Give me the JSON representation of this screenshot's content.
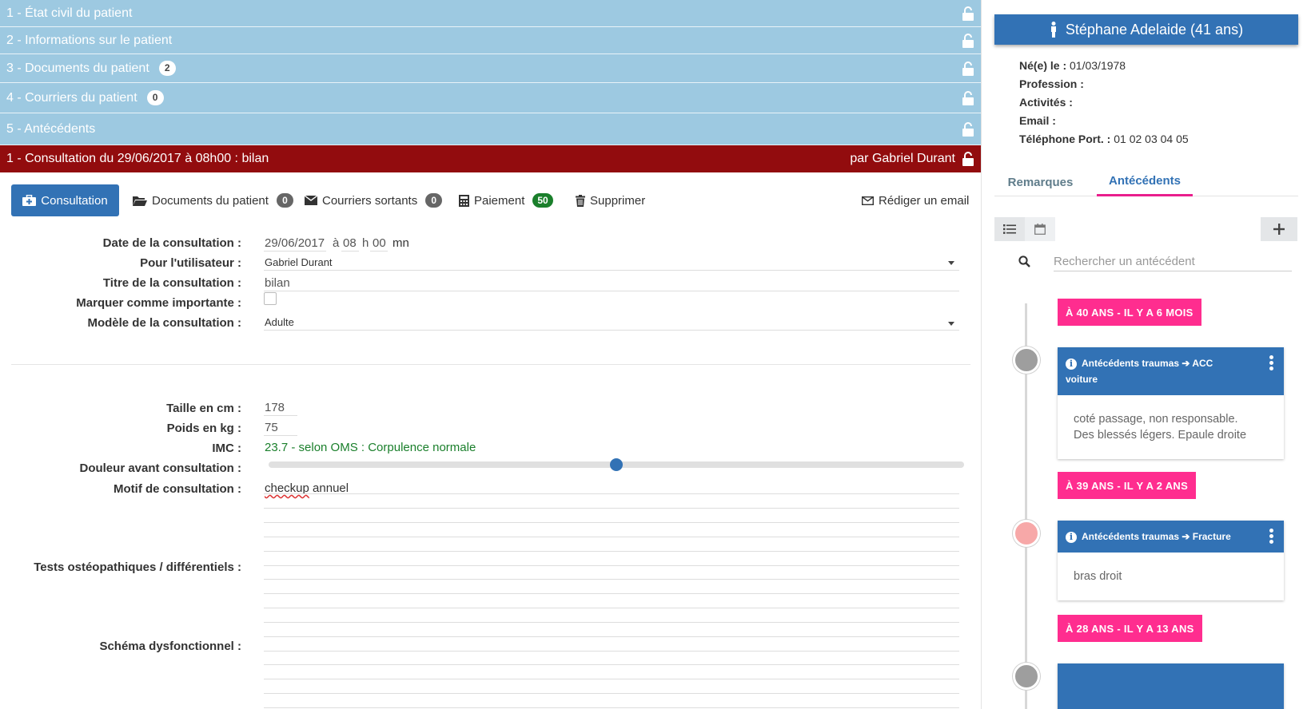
{
  "accordion": [
    {
      "label": "1 - État civil du patient",
      "badge": null
    },
    {
      "label": "2 - Informations sur le patient",
      "badge": null
    },
    {
      "label": "3 - Documents du patient",
      "badge": "2"
    },
    {
      "label": "4 - Courriers du patient",
      "badge": "0"
    },
    {
      "label": "5 - Antécédents",
      "badge": null
    }
  ],
  "consultation_header": {
    "title": "1 - Consultation du 29/06/2017 à 08h00 : bilan",
    "by": "par Gabriel Durant"
  },
  "toolbar": {
    "consultation": "Consultation",
    "documents": "Documents du patient",
    "documents_count": "0",
    "courriers": "Courriers sortants",
    "courriers_count": "0",
    "paiement": "Paiement",
    "paiement_count": "50",
    "supprimer": "Supprimer",
    "email": "Rédiger un email"
  },
  "form": {
    "date_label": "Date de la consultation :",
    "date_value": "29/06/2017",
    "a_text": "à",
    "hour": "08",
    "h_text": "h",
    "minutes": "00",
    "mn_text": "mn",
    "user_label": "Pour l'utilisateur :",
    "user_value": "Gabriel Durant",
    "titre_label": "Titre de la consultation :",
    "titre_value": "bilan",
    "important_label": "Marquer comme importante :",
    "modele_label": "Modèle de la consultation :",
    "modele_value": "Adulte",
    "taille_label": "Taille en cm :",
    "taille_value": "178",
    "poids_label": "Poids en kg :",
    "poids_value": "75",
    "imc_label": "IMC :",
    "imc_value": "23.7 - selon OMS : Corpulence normale",
    "douleur_label": "Douleur avant consultation :",
    "douleur_level": 0.5,
    "motif_label": "Motif de consultation :",
    "motif_word1": "checkup",
    "motif_word2": " annuel",
    "tests_label": "Tests ostéopathiques / différentiels :",
    "schema_label": "Schéma dysfonctionnel :"
  },
  "patient": {
    "name": "Stéphane Adelaide (41 ans)",
    "ne_label": "Né(e) le :",
    "ne_value": "01/03/1978",
    "profession_label": "Profession :",
    "activites_label": "Activités :",
    "email_label": "Email :",
    "tel_label": "Téléphone Port. :",
    "tel_value": "01 02 03 04 05"
  },
  "right_tabs": {
    "remarques": "Remarques",
    "antecedents": "Antécédents"
  },
  "search": {
    "placeholder": "Rechercher un antécédent"
  },
  "timeline": [
    {
      "tag": "À 40 ANS - IL Y A 6 MOIS",
      "title_line1": "Antécédents traumas ➔ ACC",
      "title_line2": "voiture",
      "body_line1": "coté passage, non responsable.",
      "body_line2": "Des blessés légers. Epaule droite",
      "dot_color": "#9e9e9e"
    },
    {
      "tag": "À 39 ANS - IL Y A 2 ANS",
      "title_line1": "Antécédents traumas ➔ Fracture",
      "title_line2": "",
      "body_line1": "bras droit",
      "body_line2": "",
      "dot_color": "#f7a8a8"
    },
    {
      "tag": "À 28 ANS - IL Y A 13 ANS"
    }
  ],
  "colors": {
    "accordion": "#9dc9e1",
    "consultation_bar": "#920c0e",
    "primary": "#3272b5",
    "pink": "#ff2d8f",
    "green": "#1a7f2b"
  }
}
